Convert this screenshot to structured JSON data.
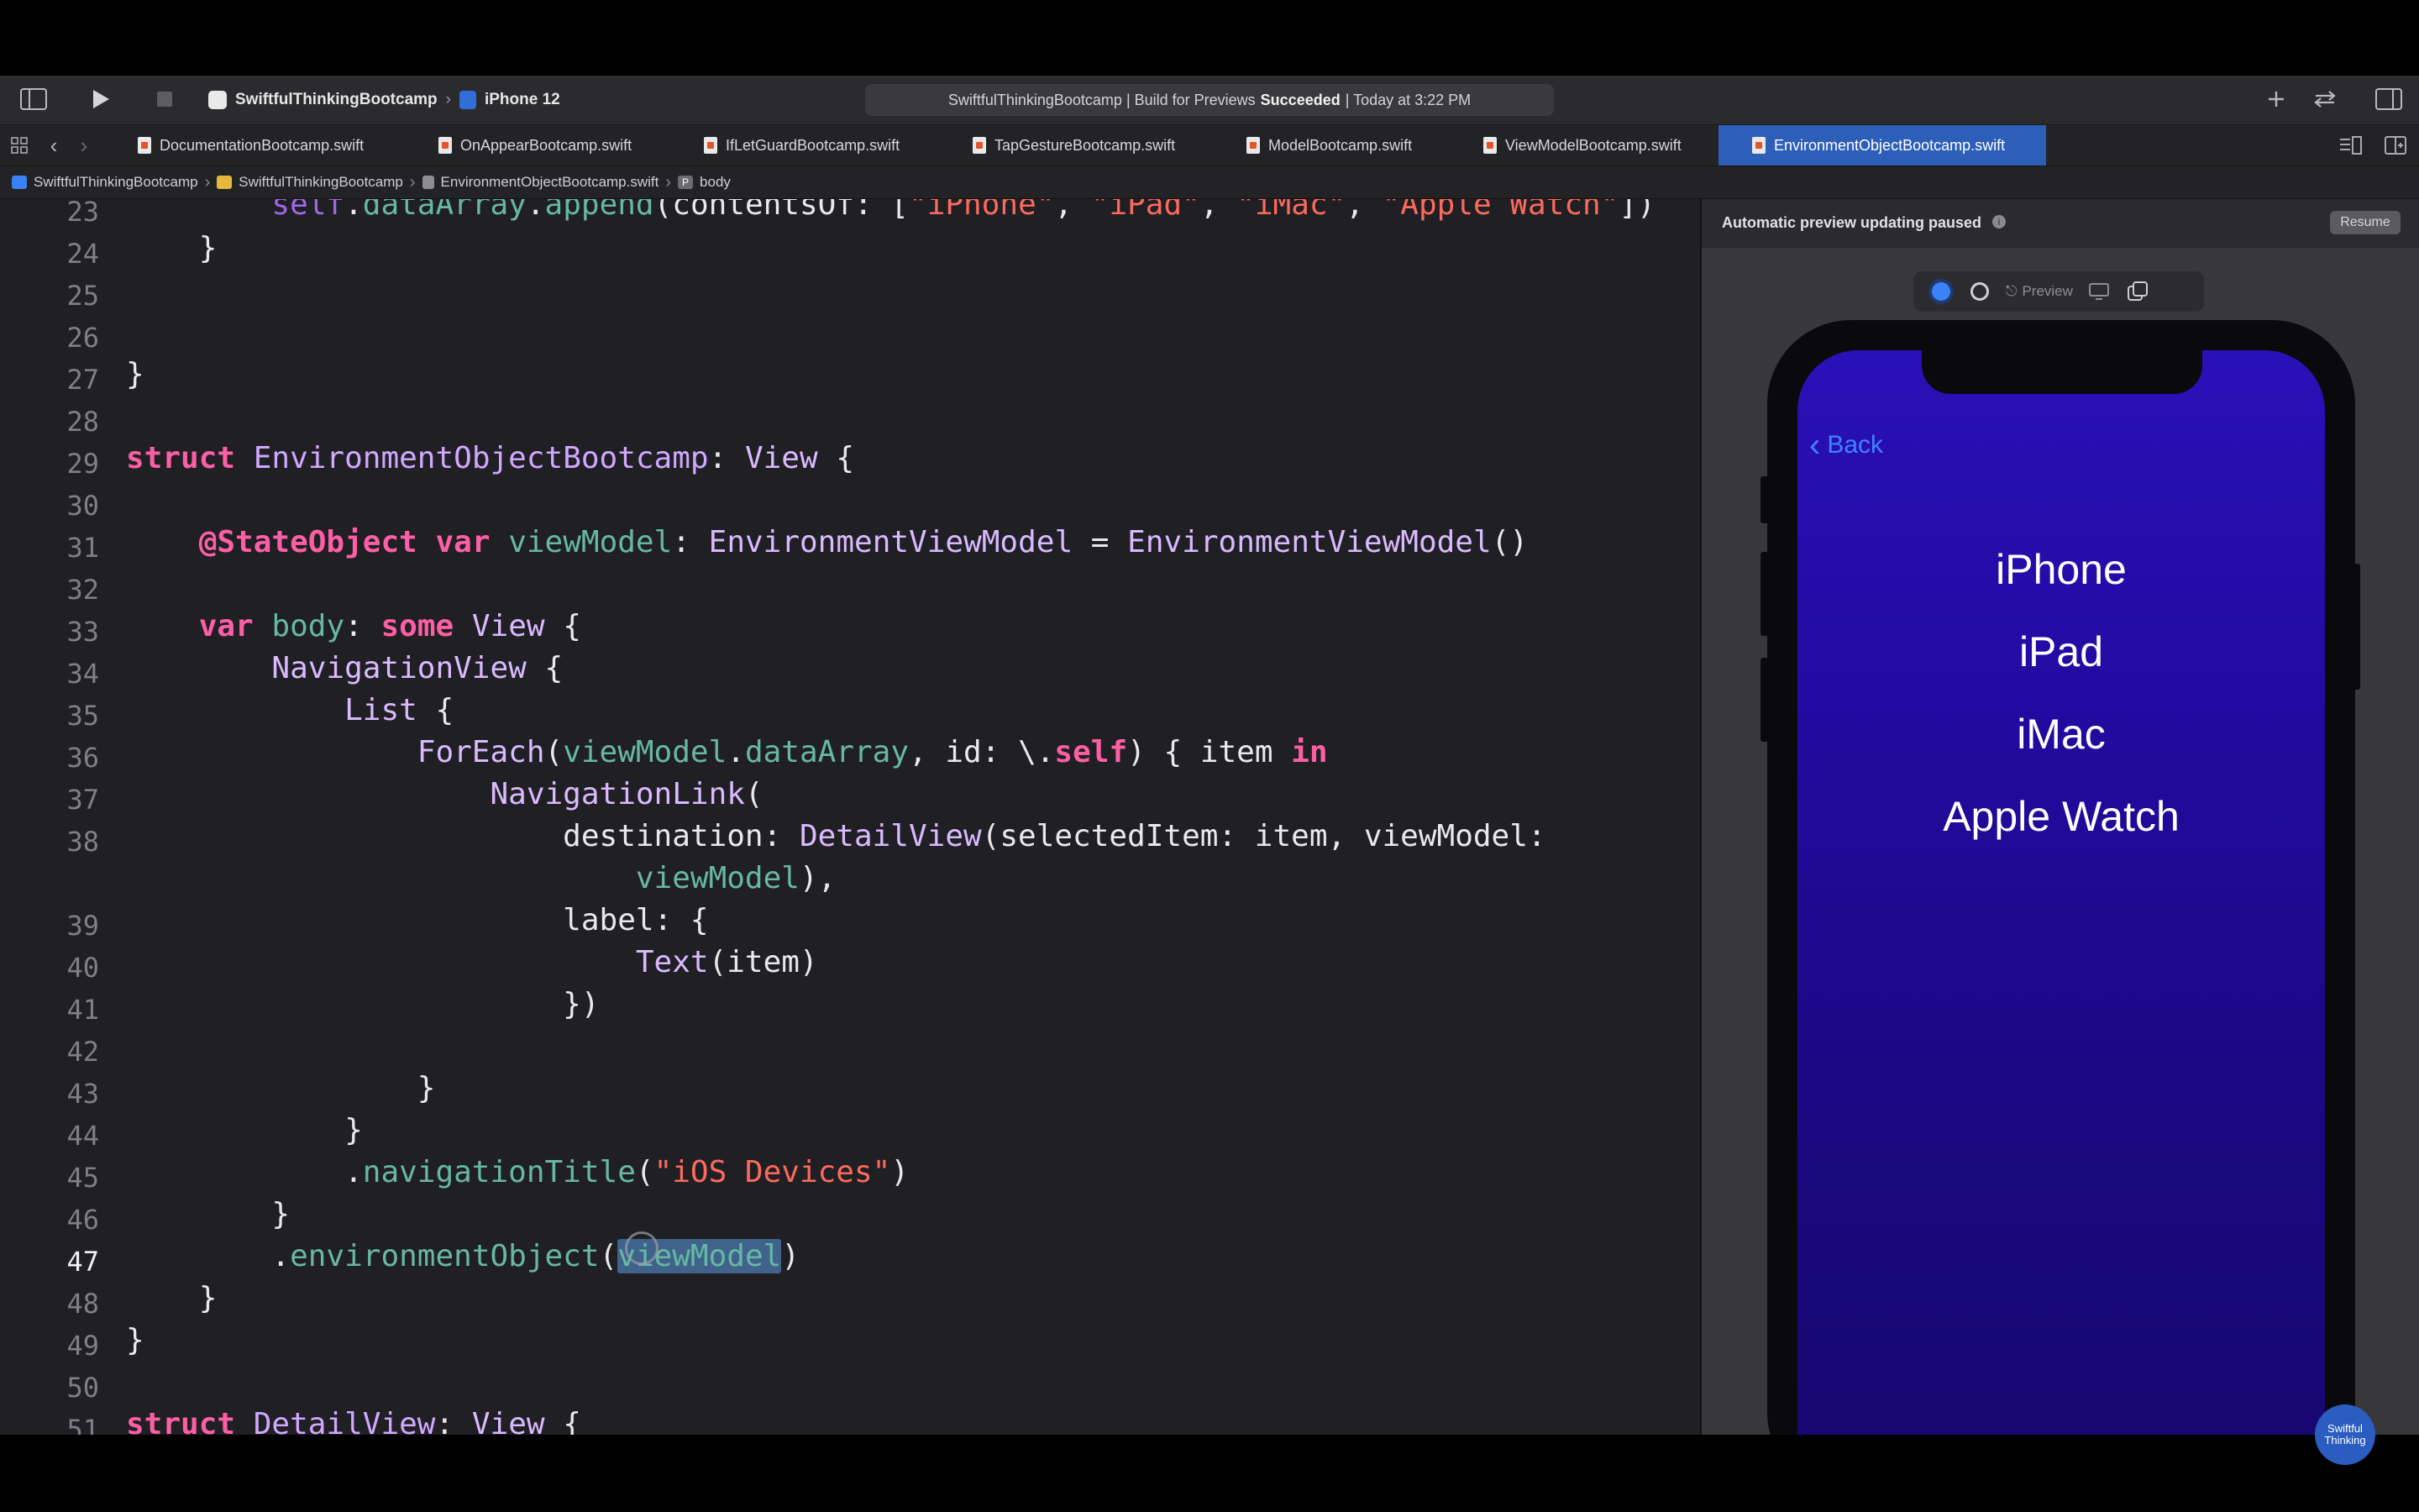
{
  "toolbar": {
    "project": "SwiftfulThinkingBootcamp",
    "device": "iPhone 12",
    "status_prefix": "SwiftfulThinkingBootcamp | Build for Previews",
    "status_result": "Succeeded",
    "status_time": "| Today at 3:22 PM"
  },
  "tabs": [
    {
      "label": "DocumentationBootcamp.swift"
    },
    {
      "label": "OnAppearBootcamp.swift"
    },
    {
      "label": "IfLetGuardBootcamp.swift"
    },
    {
      "label": "TapGestureBootcamp.swift"
    },
    {
      "label": "ModelBootcamp.swift"
    },
    {
      "label": "ViewModelBootcamp.swift"
    },
    {
      "label": "EnvironmentObjectBootcamp.swift"
    }
  ],
  "jumpbar": {
    "project": "SwiftfulThinkingBootcamp",
    "folder": "SwiftfulThinkingBootcamp",
    "file": "EnvironmentObjectBootcamp.swift",
    "symbol": "body"
  },
  "editor": {
    "line_numbers": [
      "23",
      "24",
      "25",
      "26",
      "27",
      "28",
      "29",
      "30",
      "31",
      "32",
      "33",
      "34",
      "35",
      "36",
      "37",
      "38",
      "",
      "39",
      "40",
      "41",
      "42",
      "43",
      "44",
      "45",
      "46",
      "47",
      "48",
      "49",
      "50",
      "51"
    ],
    "current_line": "47"
  },
  "canvas": {
    "message": "Automatic preview updating paused",
    "resume": "Resume",
    "preview_label": "Preview"
  },
  "simulator": {
    "back": "Back",
    "items": [
      "iPhone",
      "iPad",
      "iMac",
      "Apple Watch"
    ]
  },
  "watermark": "Swiftful Thinking",
  "colors": {
    "accent": "#2d5fb8",
    "keyword": "#fc5fa3",
    "string": "#fc6a5d",
    "type": "#d0a8ff",
    "phone_background": "#2a10b8",
    "back_link": "#3d84ff"
  }
}
